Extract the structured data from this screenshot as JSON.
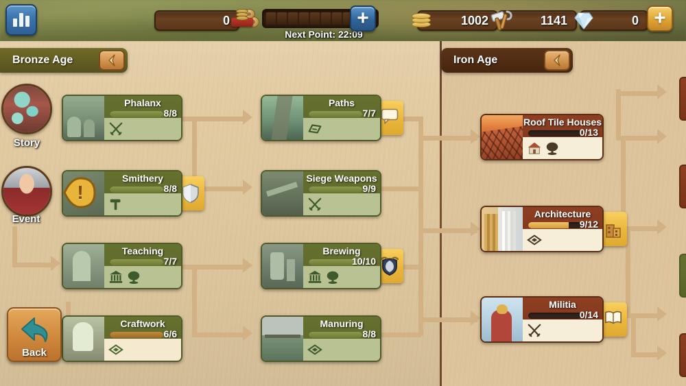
{
  "topbar": {
    "stats_button": "stats-icon",
    "resources": [
      {
        "name": "relics",
        "icon": "relic-cushion-icon",
        "value": "0"
      },
      {
        "name": "coins",
        "icon": "coin-stack-icon",
        "value": "1002"
      },
      {
        "name": "supplies",
        "icon": "hammer-tools-icon",
        "value": "1141"
      },
      {
        "name": "diamonds",
        "icon": "diamond-icon",
        "value": "0"
      }
    ],
    "forge_points": {
      "icon": "forge-point-icon",
      "slots_total": 10,
      "slots_filled": 0,
      "next_point_label": "Next Point: 22:09",
      "add_button": "plus-icon"
    },
    "diamond_add_button": "plus-icon"
  },
  "sidebar": {
    "avatars": [
      {
        "name": "story",
        "label": "Story",
        "icon": "fortune-teller-avatar"
      },
      {
        "name": "event",
        "label": "Event",
        "icon": "football-player-avatar"
      }
    ],
    "back_button": {
      "label": "Back",
      "icon": "back-arrow-icon"
    }
  },
  "ages": [
    {
      "id": "bronze",
      "label": "Bronze Age",
      "collapse_icon": "chevron-left-icon"
    },
    {
      "id": "iron",
      "label": "Iron Age",
      "collapse_icon": "chevron-left-icon"
    }
  ],
  "columns": {
    "bronze_a": [
      {
        "name": "phalanx",
        "title": "Phalanx",
        "count": "8/8",
        "progress": 100,
        "state": "researched",
        "icons": [
          "crossed-swords-icon"
        ],
        "art": "art-phalanx",
        "reward": null,
        "alert": false
      },
      {
        "name": "smithery",
        "title": "Smithery",
        "count": "8/8",
        "progress": 100,
        "state": "researched",
        "icons": [
          "hammer-icon"
        ],
        "art": "art-smithery",
        "reward": "shield-icon",
        "alert": true
      },
      {
        "name": "teaching",
        "title": "Teaching",
        "count": "7/7",
        "progress": 100,
        "state": "researched",
        "icons": [
          "temple-icon",
          "tree-icon"
        ],
        "art": "art-teaching",
        "reward": null,
        "alert": false
      },
      {
        "name": "craftwork",
        "title": "Craftwork",
        "count": "6/6",
        "progress": 100,
        "state": "researched-cream",
        "icons": [
          "gem-diamond-icon"
        ],
        "art": "art-craftwork",
        "reward": null,
        "alert": false
      }
    ],
    "bronze_b": [
      {
        "name": "paths",
        "title": "Paths",
        "count": "7/7",
        "progress": 100,
        "state": "researched",
        "icons": [
          "road-icon"
        ],
        "art": "art-paths",
        "reward": "speech-bubble-icon",
        "alert": false
      },
      {
        "name": "siege-weapons",
        "title": "Siege Weapons",
        "count": "9/9",
        "progress": 100,
        "state": "researched",
        "icons": [
          "crossed-swords-icon"
        ],
        "art": "art-siege",
        "reward": null,
        "alert": false
      },
      {
        "name": "brewing",
        "title": "Brewing",
        "count": "10/10",
        "progress": 100,
        "state": "researched",
        "icons": [
          "temple-icon",
          "tree-icon"
        ],
        "art": "art-brewing",
        "reward": "crest-shield-icon",
        "alert": false
      },
      {
        "name": "manuring",
        "title": "Manuring",
        "count": "8/8",
        "progress": 100,
        "state": "researched",
        "icons": [
          "gem-diamond-icon"
        ],
        "art": "art-manuring",
        "reward": null,
        "alert": false
      }
    ],
    "iron": [
      {
        "name": "roof-tile-houses",
        "title": "Roof Tile Houses",
        "count": "0/13",
        "progress": 0,
        "state": "locked",
        "icons": [
          "house-icon",
          "tree-icon"
        ],
        "art": "art-roof",
        "reward": null,
        "alert": false
      },
      {
        "name": "architecture",
        "title": "Architecture",
        "count": "9/12",
        "progress": 75,
        "state": "in-progress",
        "icons": [
          "gem-diamond-icon"
        ],
        "art": "art-arch",
        "reward": "building-icon",
        "alert": false
      },
      {
        "name": "militia",
        "title": "Militia",
        "count": "0/14",
        "progress": 0,
        "state": "locked",
        "icons": [
          "crossed-swords-icon"
        ],
        "art": "art-militia",
        "reward": "open-book-icon",
        "alert": false
      }
    ]
  },
  "colors": {
    "parchment": "#e2cba2",
    "researched_header": "#66712f",
    "locked_header": "#8e3f22",
    "reward_gold": "#f8cf5e",
    "connector": "#d2b185",
    "topbar_green": "#7d8447"
  }
}
